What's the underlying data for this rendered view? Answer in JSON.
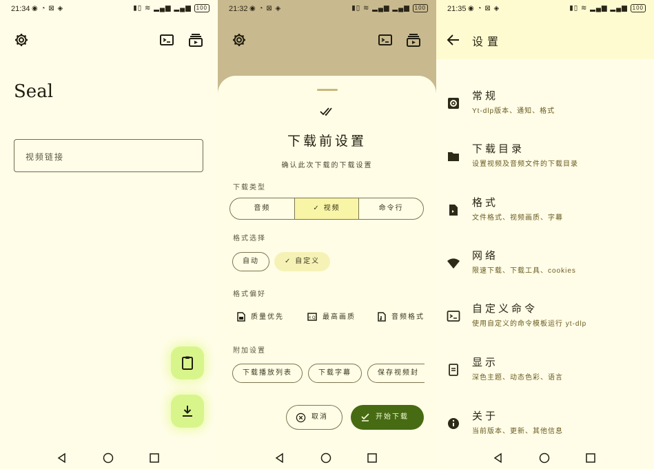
{
  "panel1": {
    "status": {
      "time": "21:34",
      "battery": "100"
    },
    "title": "Seal",
    "url_placeholder": "视频链接"
  },
  "panel2": {
    "status": {
      "time": "21:32",
      "battery": "100"
    },
    "sheet_title": "下载前设置",
    "sheet_subtitle": "确认此次下载的下载设置",
    "download_type_label": "下载类型",
    "type_options": [
      "音频",
      "视频",
      "命令行"
    ],
    "selected_type": "视频",
    "format_select_label": "格式选择",
    "format_chips": [
      "自动",
      "自定义"
    ],
    "selected_format": "自定义",
    "format_pref_label": "格式偏好",
    "prefs": [
      "质量优先",
      "最高画质",
      "音频格式"
    ],
    "extra_label": "附加设置",
    "extra_chips": [
      "下载播放列表",
      "下载字幕",
      "保存视频封"
    ],
    "cancel_label": "取消",
    "start_label": "开始下载"
  },
  "panel3": {
    "status": {
      "time": "21:35",
      "battery": "100"
    },
    "title": "设置",
    "items": [
      {
        "title": "常规",
        "desc": "Yt-dlp版本、通知、格式",
        "icon": "settings-icon"
      },
      {
        "title": "下载目录",
        "desc": "设置视频及音频文件的下载目录",
        "icon": "folder-icon"
      },
      {
        "title": "格式",
        "desc": "文件格式、视频画质、字幕",
        "icon": "file-icon"
      },
      {
        "title": "网络",
        "desc": "限速下载、下载工具、cookies",
        "icon": "wifi-icon"
      },
      {
        "title": "自定义命令",
        "desc": "使用自定义的命令模板运行 yt-dlp",
        "icon": "terminal-icon"
      },
      {
        "title": "显示",
        "desc": "深色主题、动态色彩、语言",
        "icon": "display-icon"
      },
      {
        "title": "关于",
        "desc": "当前版本、更新、其他信息",
        "icon": "info-icon"
      }
    ]
  },
  "colors": {
    "accent": "#466b13",
    "fab": "#d8f58c",
    "scrim": "#c8b98f",
    "background": "#fffde8"
  }
}
